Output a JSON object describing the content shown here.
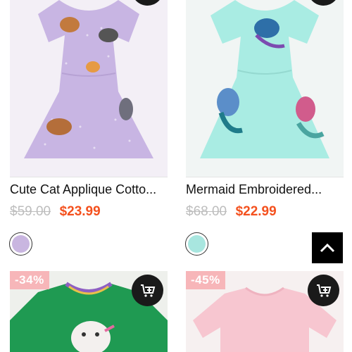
{
  "products": [
    {
      "title": "Cute Cat Applique Cotto...",
      "old_price": "$59.00",
      "price": "$23.99",
      "swatch_color": "#c9b6e0",
      "image_color": "#c8b5e3",
      "cart_icon": "add-to-cart-icon"
    },
    {
      "title": "Mermaid Embroidered...",
      "old_price": "$68.00",
      "price": "$22.99",
      "swatch_color": "#a8e6df",
      "image_color": "#a9ece3",
      "cart_icon": "add-to-cart-icon"
    },
    {
      "discount": "-34%",
      "image_color": "#1f9a52",
      "cart_icon": "add-to-cart-icon"
    },
    {
      "discount": "-45%",
      "image_color": "#f7c6d0",
      "cart_icon": "add-to-cart-icon"
    }
  ],
  "back_to_top_icon": "chevron-up-icon",
  "colors": {
    "sale_price": "#f4511e",
    "old_price": "#bdbdbd",
    "badge_bg": "#f7b6b9",
    "button_bg": "#1a1a1a"
  }
}
